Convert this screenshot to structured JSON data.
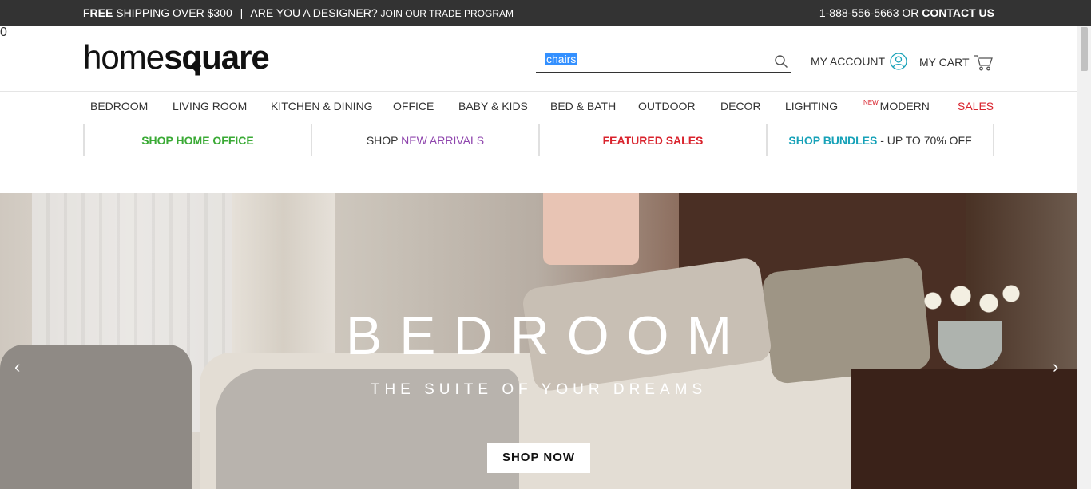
{
  "topbar": {
    "free_label": "FREE",
    "shipping_text": "SHIPPING OVER $300",
    "separator": "|",
    "designer_text": "ARE YOU A DESIGNER?",
    "trade_link": "JOIN OUR TRADE PROGRAM",
    "phone": "1-888-556-5663",
    "or_text": "OR",
    "contact_link": "CONTACT US"
  },
  "header": {
    "logo_thin": "home",
    "logo_bold_s": "s",
    "logo_bold_q": "q",
    "logo_bold_rest": "uare",
    "search": {
      "value": "chairs"
    },
    "account_label": "MY ACCOUNT",
    "cart_label": "MY CART",
    "cart_count": "0"
  },
  "nav": {
    "items": [
      {
        "label": "BEDROOM"
      },
      {
        "label": "LIVING ROOM"
      },
      {
        "label": "KITCHEN & DINING"
      },
      {
        "label": "OFFICE"
      },
      {
        "label": "BABY & KIDS"
      },
      {
        "label": "BED & BATH"
      },
      {
        "label": "OUTDOOR"
      },
      {
        "label": "DECOR"
      },
      {
        "label": "LIGHTING"
      },
      {
        "label": "MODERN",
        "badge": "NEW"
      },
      {
        "label": "SALES"
      }
    ]
  },
  "promo": {
    "home_office": "SHOP HOME OFFICE",
    "new_arrivals_prefix": "SHOP",
    "new_arrivals": "NEW ARRIVALS",
    "featured_sales": "FEATURED SALES",
    "bundles": "SHOP BUNDLES",
    "bundles_suffix": "- UP TO 70% OFF"
  },
  "hero": {
    "title": "BEDROOM",
    "subtitle": "THE SUITE OF YOUR DREAMS",
    "cta": "SHOP NOW",
    "prev_arrow": "‹",
    "next_arrow": "›"
  },
  "colors": {
    "topbar_bg": "#333333",
    "sales_red": "#d9232d",
    "green": "#3aaa35",
    "purple": "#8e44ad",
    "teal": "#17a2b8",
    "selection": "#3390ff"
  }
}
